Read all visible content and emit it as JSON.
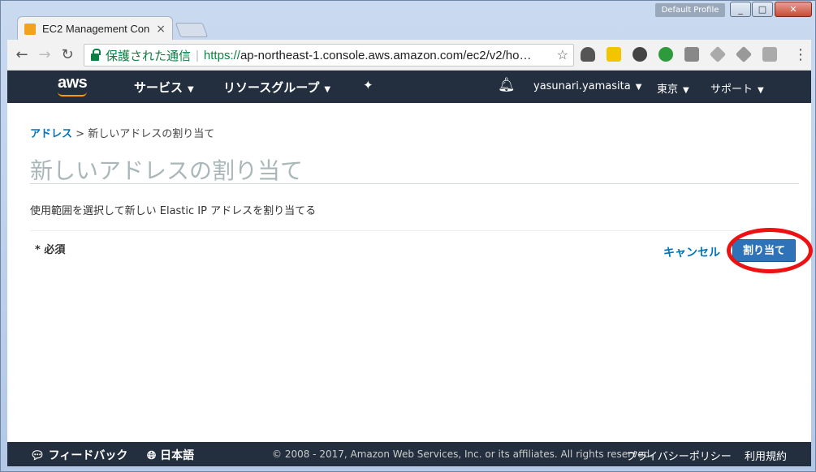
{
  "browser": {
    "profile_label": "Default Profile",
    "tab_title": "EC2 Management Con",
    "tab_close": "×",
    "url_secure_label": "保護された通信",
    "url_scheme": "https://",
    "url_rest": "ap-northeast-1.console.aws.amazon.com/ec2/v2/ho…"
  },
  "aws_nav": {
    "logo": "aws",
    "services": "サービス",
    "resource_groups": "リソースグループ",
    "user": "yasunari.yamasita",
    "region": "東京",
    "support": "サポート"
  },
  "page": {
    "breadcrumb_link": "アドレス",
    "breadcrumb_sep": " > ",
    "breadcrumb_current": "新しいアドレスの割り当て",
    "title": "新しいアドレスの割り当て",
    "description": "使用範囲を選択して新しい Elastic IP アドレスを割り当てる",
    "required_label": "* 必須",
    "cancel_label": "キャンセル",
    "allocate_label": "割り当て"
  },
  "footer": {
    "feedback": "フィードバック",
    "language": "日本語",
    "copyright": "© 2008 - 2017, Amazon Web Services, Inc. or its affiliates. All rights reserved.",
    "privacy": "プライバシーポリシー",
    "terms": "利用規約"
  },
  "colors": {
    "aws_nav_bg": "#232f3e",
    "link_blue": "#0073bb",
    "primary_button": "#2e73b8",
    "highlight_circle": "#ee1111"
  }
}
